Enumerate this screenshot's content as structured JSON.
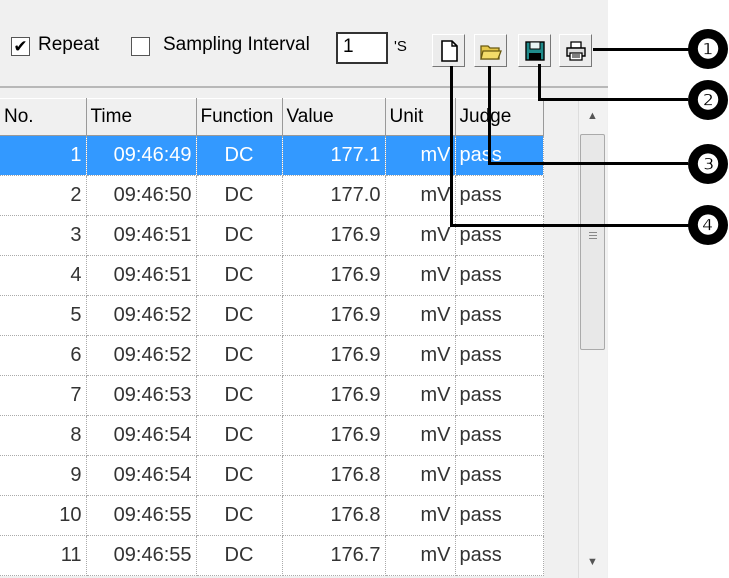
{
  "toolbar": {
    "repeat_checked": "✔",
    "repeat_label": "Repeat",
    "sampling_checked": "",
    "sampling_label": "Sampling Interval",
    "interval_value": "1",
    "interval_unit": "'S",
    "buttons": [
      "new-file-icon",
      "open-folder-icon",
      "save-icon",
      "print-icon"
    ]
  },
  "table": {
    "headers": [
      "No.",
      "Time",
      "Function",
      "Value",
      "Unit",
      "Judge"
    ],
    "rows": [
      [
        "1",
        "09:46:49",
        "DC",
        "177.1",
        "mV",
        "pass"
      ],
      [
        "2",
        "09:46:50",
        "DC",
        "177.0",
        "mV",
        "pass"
      ],
      [
        "3",
        "09:46:51",
        "DC",
        "176.9",
        "mV",
        "pass"
      ],
      [
        "4",
        "09:46:51",
        "DC",
        "176.9",
        "mV",
        "pass"
      ],
      [
        "5",
        "09:46:52",
        "DC",
        "176.9",
        "mV",
        "pass"
      ],
      [
        "6",
        "09:46:52",
        "DC",
        "176.9",
        "mV",
        "pass"
      ],
      [
        "7",
        "09:46:53",
        "DC",
        "176.9",
        "mV",
        "pass"
      ],
      [
        "8",
        "09:46:54",
        "DC",
        "176.9",
        "mV",
        "pass"
      ],
      [
        "9",
        "09:46:54",
        "DC",
        "176.8",
        "mV",
        "pass"
      ],
      [
        "10",
        "09:46:55",
        "DC",
        "176.8",
        "mV",
        "pass"
      ],
      [
        "11",
        "09:46:55",
        "DC",
        "176.7",
        "mV",
        "pass"
      ]
    ],
    "selected_row": 0
  },
  "callouts": [
    "❶",
    "❷",
    "❸",
    "❹"
  ]
}
